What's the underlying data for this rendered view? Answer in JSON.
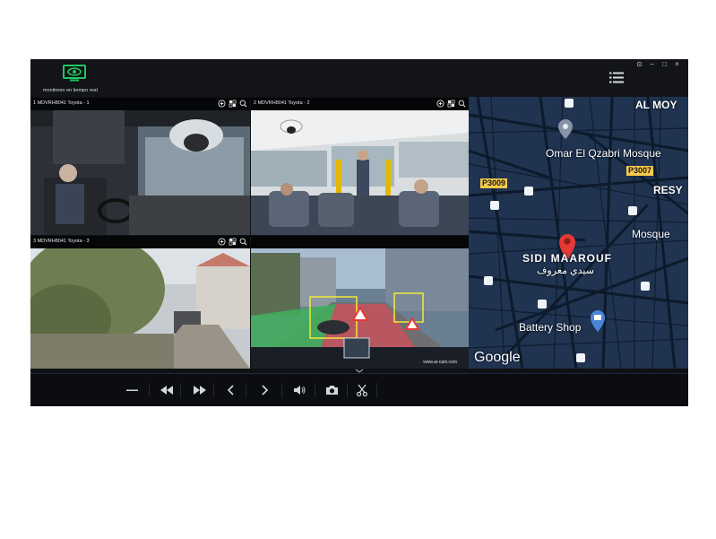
{
  "app": {
    "title": "monitoreo en tiempo real",
    "logo_icon": "monitor-eye-icon",
    "accent": "#22c55e",
    "window_controls": [
      "⊙",
      "−",
      "□",
      "×"
    ]
  },
  "menu_icon": "list-menu-icon",
  "cameras": [
    {
      "label": "1 MDVRH8041 Toyota - 1",
      "scene": "bus driver cabin"
    },
    {
      "label": "2 MDVRH8041 Toyota - 2",
      "scene": "bus passenger interior"
    },
    {
      "label": "3 MDVRH8041 Toyota - 3",
      "scene": "street rear view"
    },
    {
      "label": "",
      "scene": "ADAS road view"
    }
  ],
  "tile_tools": [
    "add-circle-icon",
    "grid-icon",
    "search-icon"
  ],
  "map": {
    "labels": {
      "top": "AL MOY",
      "mosque1": "Omar El Qzabri Mosque",
      "district": "SIDI MAAROUF",
      "district_ar": "سيدي معروف",
      "mosque2": "Mosque",
      "shop": "Battery Shop",
      "resy": "RESY",
      "logo": "Google"
    },
    "roads": [
      "P3009",
      "P3007"
    ],
    "colors": {
      "background": "#1e2f46",
      "streets": "#0d1a2b",
      "pin": "#e53935",
      "road_sign": "#f7c94a"
    }
  },
  "controls": {
    "speed_label": "▬▬▬",
    "buttons": [
      "speed-icon",
      "rewind-icon",
      "fast-forward-icon",
      "previous-icon",
      "next-icon",
      "volume-icon",
      "camera-icon",
      "scissors-icon"
    ]
  },
  "ads": {
    "badge": "www.ai-cam.com"
  }
}
